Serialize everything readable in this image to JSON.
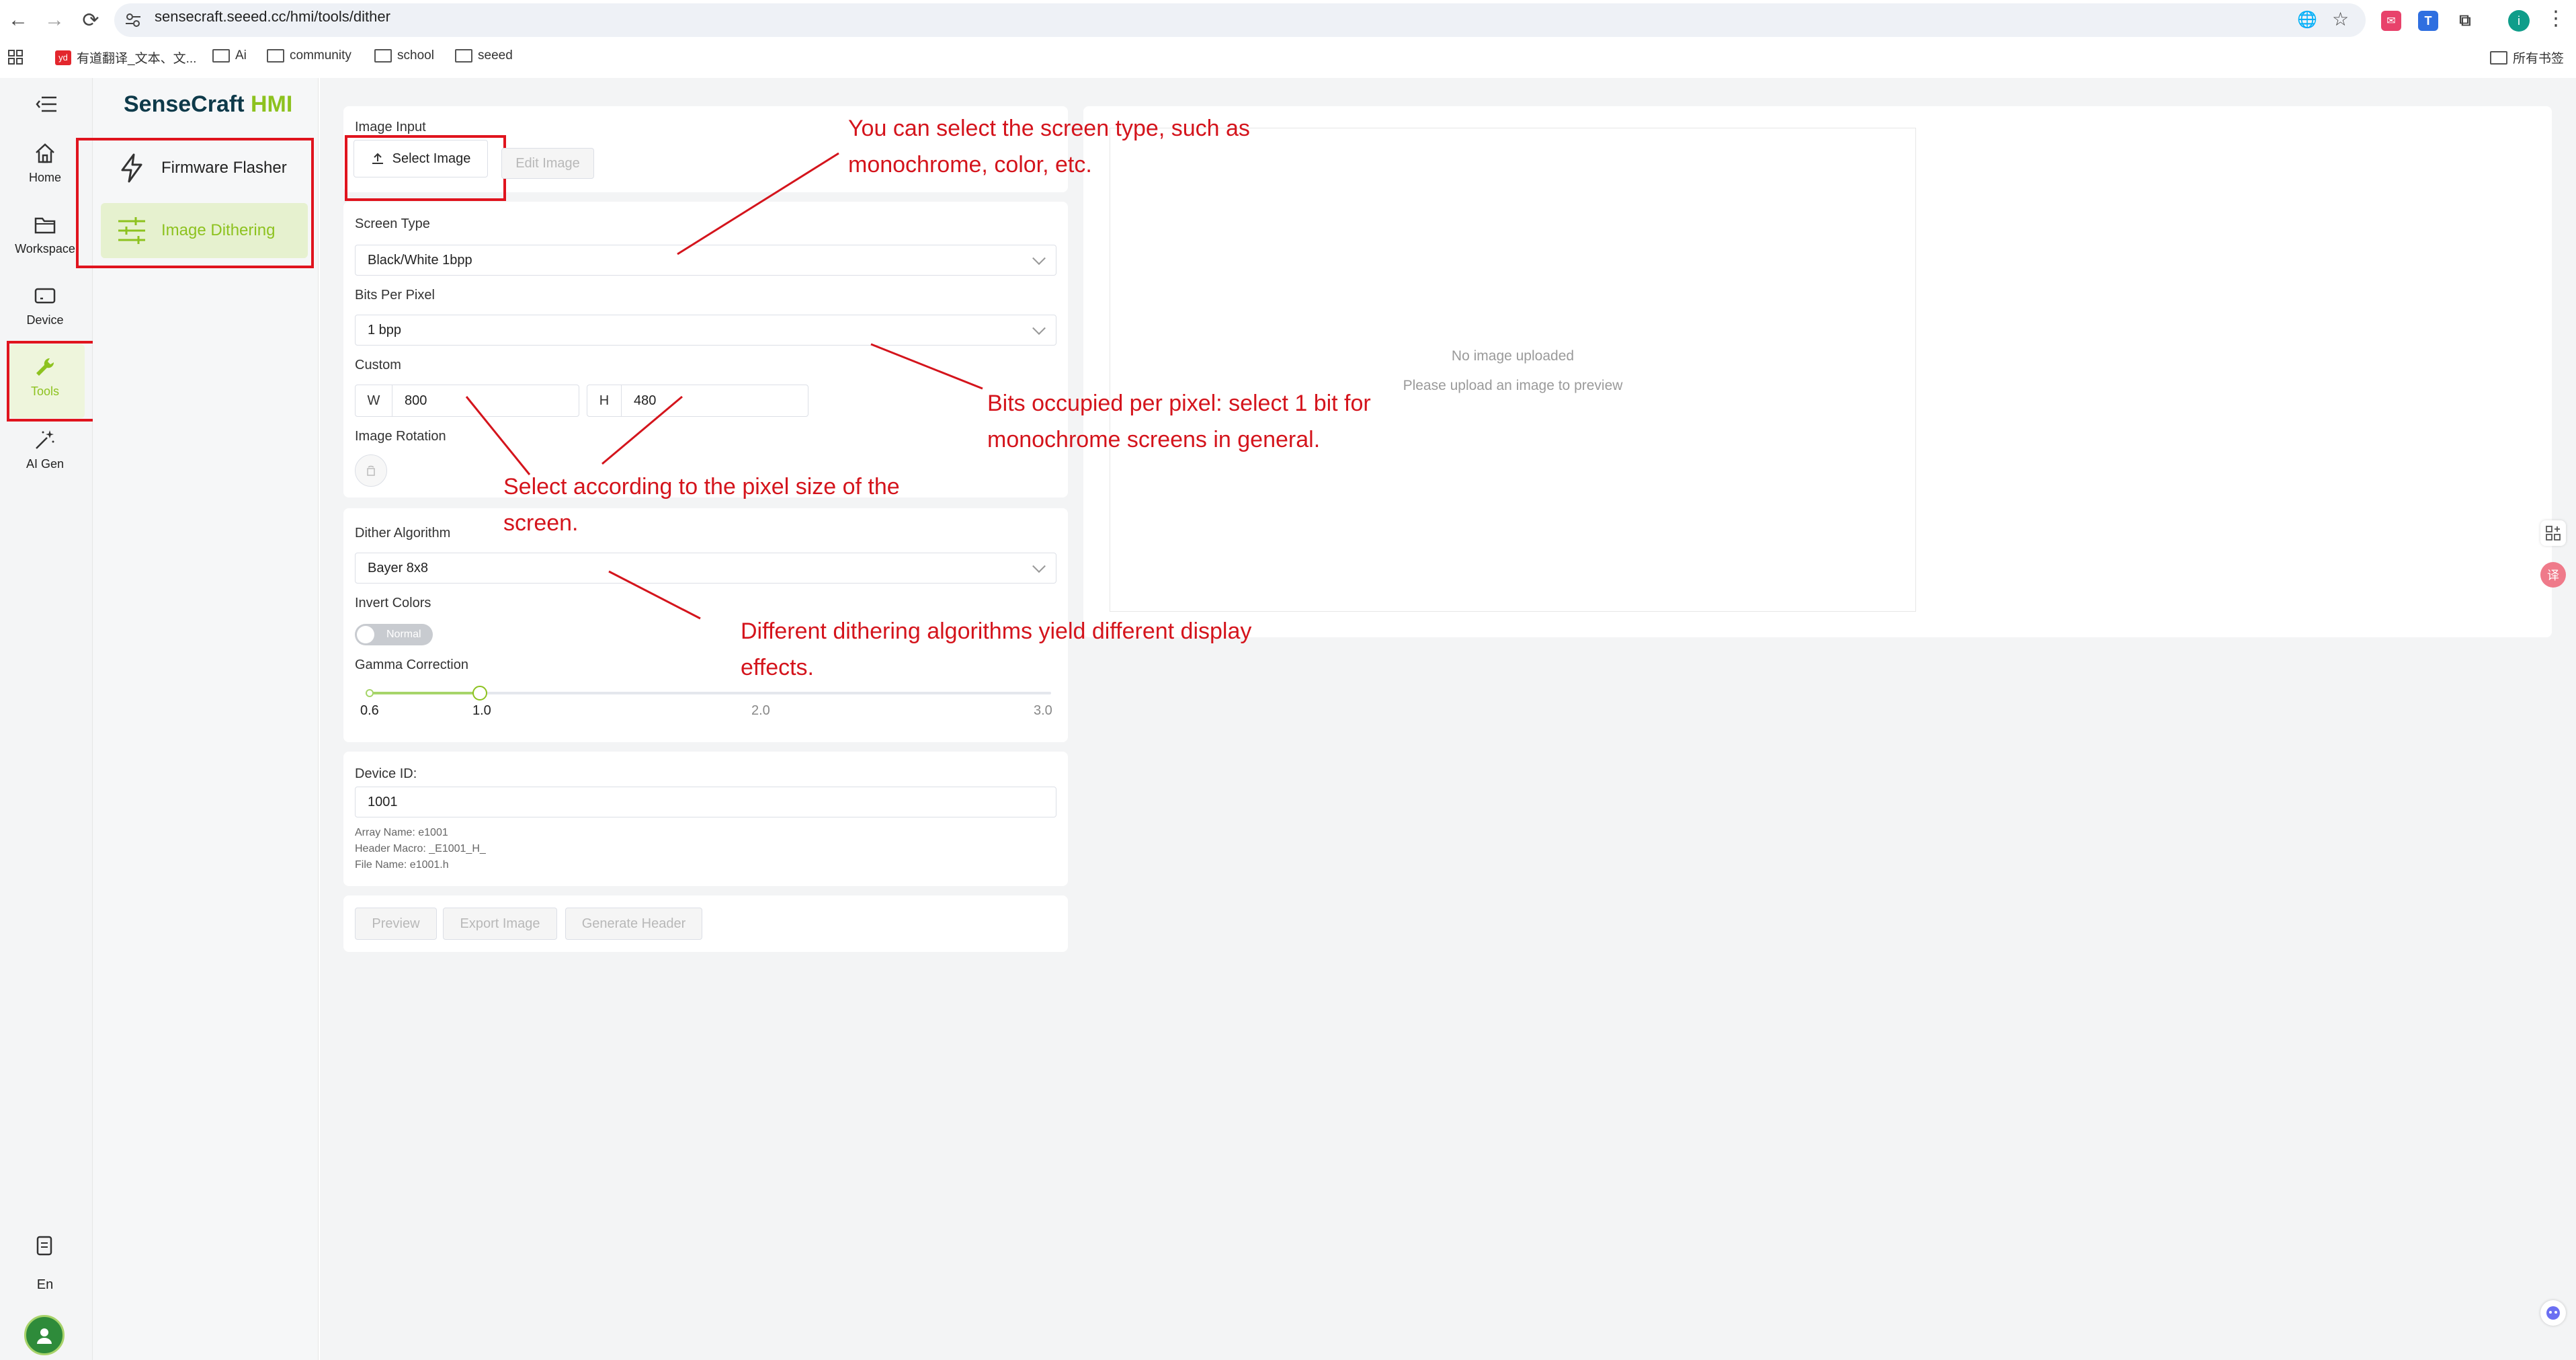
{
  "browser": {
    "url": "sensecraft.seeed.cc/hmi/tools/dither",
    "bookmarks": [
      "有道翻译_文本、文...",
      "Ai",
      "community",
      "school",
      "seeed"
    ],
    "all_bookmarks": "所有书签",
    "avatar_letter": "i"
  },
  "app": {
    "logo_main": "SenseCraft",
    "logo_accent": "HMI",
    "rail": [
      {
        "label": "Home"
      },
      {
        "label": "Workspace"
      },
      {
        "label": "Device"
      },
      {
        "label": "Tools"
      },
      {
        "label": "AI Gen"
      }
    ],
    "rail_bottom_lang": "En",
    "submenu": [
      {
        "label": "Firmware Flasher"
      },
      {
        "label": "Image Dithering"
      }
    ],
    "accent_color": "#8dc21f"
  },
  "form": {
    "image_input_label": "Image Input",
    "select_image_btn": "Select Image",
    "edit_image_btn": "Edit Image",
    "screen_type_label": "Screen Type",
    "screen_type_value": "Black/White 1bpp",
    "bpp_label": "Bits Per Pixel",
    "bpp_value": "1 bpp",
    "custom_label": "Custom",
    "w_label": "W",
    "w_value": "800",
    "h_label": "H",
    "h_value": "480",
    "rotation_label": "Image Rotation",
    "dither_label": "Dither Algorithm",
    "dither_value": "Bayer 8x8",
    "invert_label": "Invert Colors",
    "invert_state": "Normal",
    "gamma_label": "Gamma Correction",
    "gamma_ticks": [
      "0.6",
      "1.0",
      "2.0",
      "3.0"
    ],
    "gamma_value": 1.0,
    "device_id_label": "Device ID:",
    "device_id_value": "1001",
    "array_name": "Array Name: e1001",
    "header_macro": "Header Macro: _E1001_H_",
    "file_name": "File Name: e1001.h",
    "preview_btn": "Preview",
    "export_btn": "Export Image",
    "header_btn": "Generate Header"
  },
  "preview": {
    "empty_title": "No image uploaded",
    "empty_hint": "Please upload an image to preview"
  },
  "annotations": {
    "screen_type_note": [
      "You can select the screen type, such as",
      "monochrome, color, etc."
    ],
    "bpp_note": [
      "Bits occupied per pixel: select 1 bit for",
      "monochrome screens in general."
    ],
    "size_note": [
      "Select according to the pixel size of the",
      "screen."
    ],
    "dither_note": [
      "Different dithering algorithms yield different display",
      "effects."
    ]
  }
}
